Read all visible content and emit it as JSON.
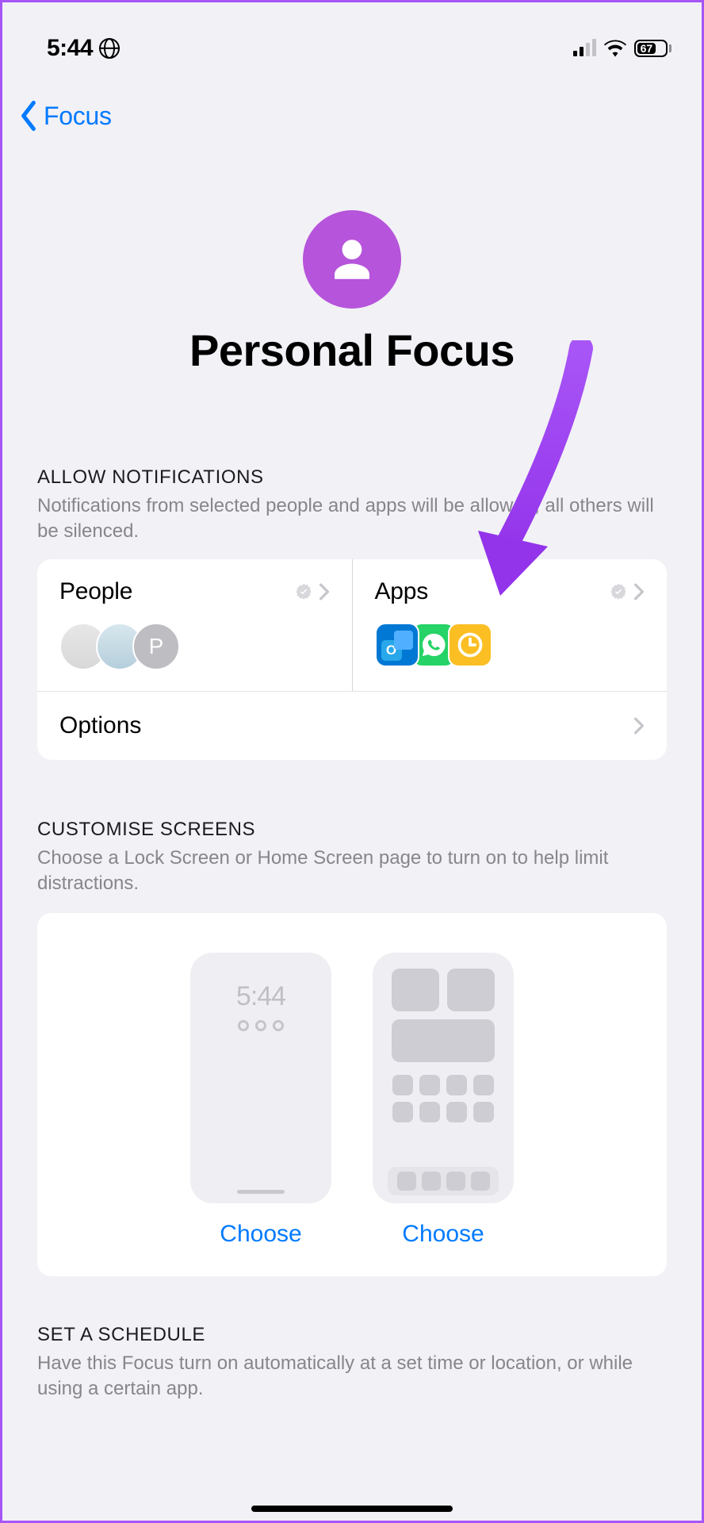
{
  "status": {
    "time": "5:44",
    "battery_pct": "67"
  },
  "nav": {
    "back_label": "Focus"
  },
  "hero": {
    "title": "Personal Focus"
  },
  "allow": {
    "header": "ALLOW NOTIFICATIONS",
    "description": "Notifications from selected people and apps will be allowed; all others will be silenced.",
    "people_label": "People",
    "apps_label": "Apps",
    "people_more_initial": "P",
    "options_label": "Options"
  },
  "customise": {
    "header": "CUSTOMISE SCREENS",
    "description": "Choose a Lock Screen or Home Screen page to turn on to help limit distractions.",
    "lock_time": "5:44",
    "choose_left": "Choose",
    "choose_right": "Choose"
  },
  "schedule": {
    "header": "SET A SCHEDULE",
    "description": "Have this Focus turn on automatically at a set time or location, or while using a certain app."
  }
}
